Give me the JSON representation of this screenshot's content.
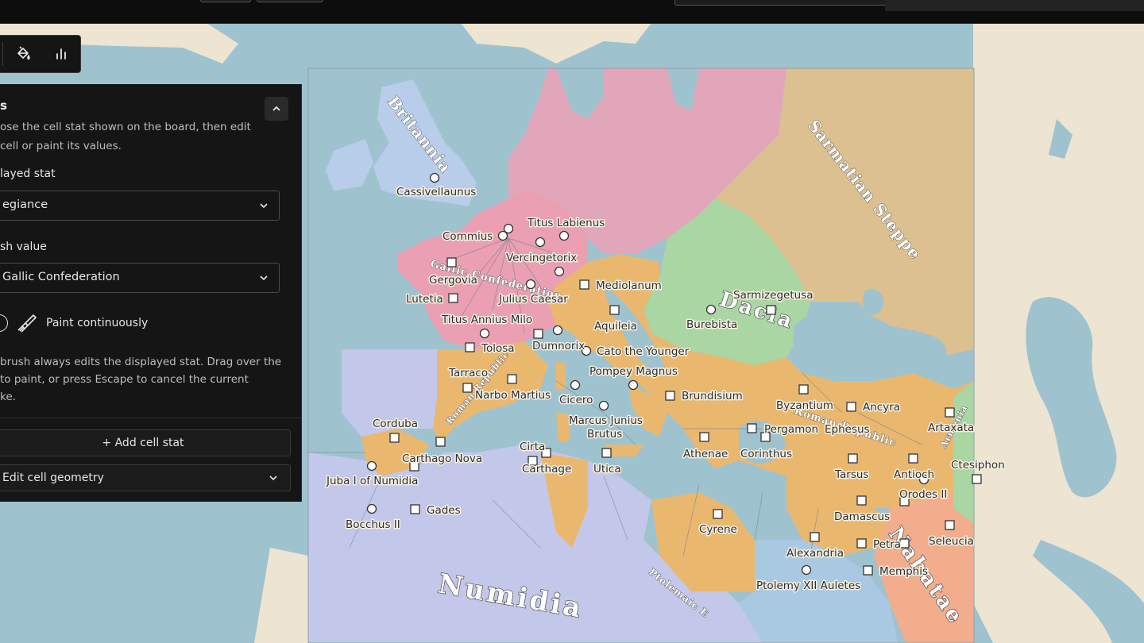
{
  "panel": {
    "title": "s",
    "description_line1": "ose the cell stat shown on the board, then edit",
    "description_line2": "cell or paint its values.",
    "displayed_stat_label": "layed stat",
    "displayed_stat_value": "egiance",
    "brush_value_label": "sh value",
    "brush_value_value": "Gallic Confederation",
    "paint_continuously_label": "Paint continuously",
    "help_line1": "brush always edits the displayed stat. Drag over the",
    "help_line2": "to paint, or press Escape to cancel the current",
    "help_line3": "ke.",
    "add_cell_stat_label": "+ Add cell stat",
    "edit_cell_geometry_label": "Edit cell geometry"
  },
  "toolbar": {
    "icons": [
      "paint-bucket-icon",
      "bar-chart-icon"
    ]
  },
  "map": {
    "region_labels": {
      "britannia": "Britannia",
      "sarmatian_steppe": "Sarmatian Steppe",
      "dacia": "Dacia",
      "numidia": "Numidia",
      "gallic_confederation": "Gallic Confederation",
      "roman_republic_west": "Roman Republic",
      "roman_republic_east": "Roman Republic",
      "armenia": "Armenia",
      "nabataea": "Nabatae",
      "ptolemaic": "Ptolemaic E"
    },
    "places": {
      "cassivellaunus": "Cassivellaunus",
      "titus_labienus": "Titus Labienus",
      "commius": "Commius",
      "vercingetorix": "Vercingetorix",
      "gergovia": "Gergovia",
      "mediolanum": "Mediolanum",
      "lutetia": "Lutetia",
      "julius_caesar": "Julius Caesar",
      "sarmizegetusa": "Sarmizegetusa",
      "titus_annius_milo": "Titus Annius Milo",
      "aquileia": "Aquileia",
      "burebista": "Burebista",
      "tolosa": "Tolosa",
      "dumnorix": "Dumnorix",
      "cato": "Cato the Younger",
      "tarraco": "Tarraco",
      "pompey": "Pompey Magnus",
      "narbo": "Narbo Martius",
      "cicero": "Cicero",
      "brundisium": "Brundisium",
      "byzantium": "Byzantium",
      "ancyra": "Ancyra",
      "corduba": "Corduba",
      "marcus_brutus_1": "Marcus Junius",
      "marcus_brutus_2": "Brutus",
      "pergamon": "Pergamon",
      "ephesus": "Ephesus",
      "artaxata": "Artaxata",
      "carthago_nova": "Carthago Nova",
      "cirta": "Cirta",
      "athenae": "Athenae",
      "corinthus": "Corinthus",
      "ctesiphon": "Ctesiphon",
      "juba": "Juba I of Numidia",
      "carthage": "Carthage",
      "utica": "Utica",
      "tarsus": "Tarsus",
      "antioch": "Antioch",
      "orodes": "Orodes II",
      "gades": "Gades",
      "damascus": "Damascus",
      "bocchus": "Bocchus II",
      "cyrene": "Cyrene",
      "seleucia": "Seleucia",
      "petra": "Petra",
      "alexandria": "Alexandria",
      "memphis": "Memphis",
      "ptolemy": "Ptolemy XII Auletes"
    }
  },
  "colors": {
    "sea": "#9ec3cf",
    "land_outside": "#ede4d2",
    "panel_bg": "#151515",
    "gallic": "#ea9fb2",
    "germanic": "#e2a6ba",
    "sarmatian": "#dcc090",
    "dacia": "#a9d6a2",
    "roman": "#eab76f",
    "numidia": "#c3c8ea",
    "nabataea": "#f2ad8c",
    "britannia": "#b8cdea",
    "ptolemaic": "#a9c9e2"
  }
}
